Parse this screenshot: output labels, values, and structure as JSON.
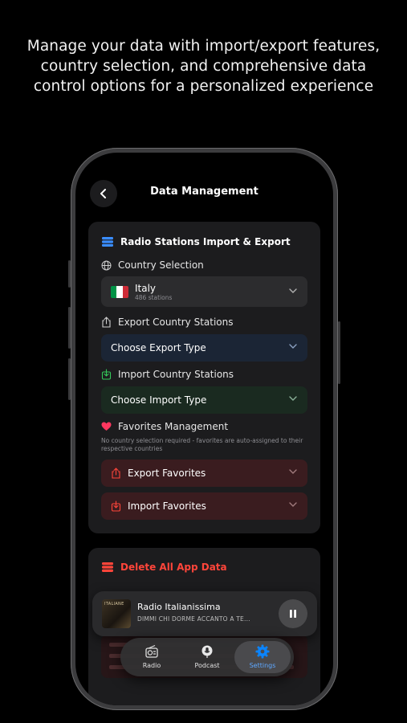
{
  "headline": {
    "line1": "Manage your data with import/export features,",
    "line2": "country selection, and comprehensive data",
    "line3": "control options for a personalized experience"
  },
  "nav": {
    "title": "Data Management",
    "back_icon": "chevron-left-icon"
  },
  "import_export": {
    "title": "Radio Stations Import & Export",
    "country_label": "Country Selection",
    "country": {
      "name": "Italy",
      "stations": "486 stations",
      "flag_colors": [
        "#009246",
        "#ffffff",
        "#ce2b37"
      ]
    },
    "export_label": "Export Country Stations",
    "export_select": "Choose Export Type",
    "import_label": "Import Country Stations",
    "import_select": "Choose Import Type",
    "favorites_label": "Favorites Management",
    "favorites_note": "No country selection required - favorites are auto-assigned to their respective countries",
    "export_favorites": "Export Favorites",
    "import_favorites": "Import Favorites"
  },
  "danger": {
    "title": "Delete All App Data"
  },
  "player": {
    "station": "Radio Italianissima",
    "track": "DIMMI CHI DORME ACCANTO A TE...",
    "art_text": "ITALIANE"
  },
  "tabs": [
    {
      "label": "Radio",
      "icon": "radio-icon",
      "active": false
    },
    {
      "label": "Podcast",
      "icon": "microphone-icon",
      "active": false
    },
    {
      "label": "Settings",
      "icon": "gear-icon",
      "active": true
    }
  ],
  "colors": {
    "accent": "#0a84ff",
    "danger": "#ff453a",
    "export_tint": "#1b2535",
    "import_tint": "#1a2a20",
    "favorites_tint": "#3a1c1f"
  }
}
